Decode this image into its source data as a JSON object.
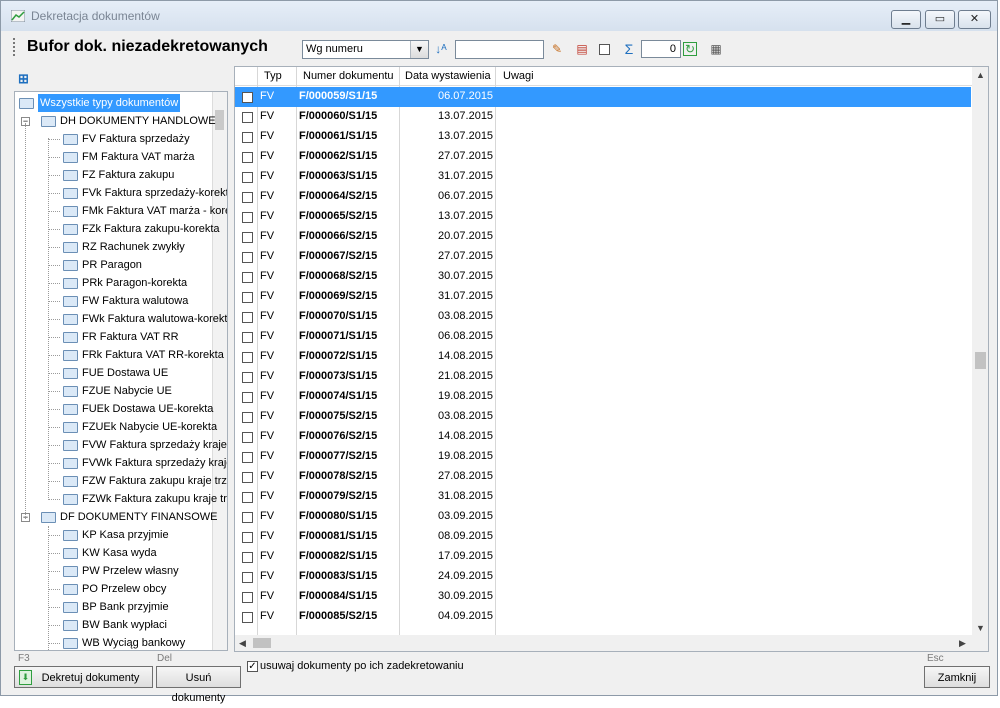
{
  "window": {
    "title": "Dekretacja dokumentów"
  },
  "toolbar": {
    "heading": "Bufor dok. niezadekretowanych",
    "sort_option": "Wg numeru",
    "search_value": "",
    "counter_value": "0"
  },
  "tree": {
    "items": [
      {
        "label": "Wszystkie typy dokumentów",
        "level": 0
      },
      {
        "label": "DH  DOKUMENTY HANDLOWE",
        "level": 1
      },
      {
        "label": "FV  Faktura sprzedaży",
        "level": 2
      },
      {
        "label": "FM  Faktura VAT marża",
        "level": 2
      },
      {
        "label": "FZ  Faktura zakupu",
        "level": 2
      },
      {
        "label": "FVk  Faktura sprzedaży-korekta",
        "level": 2
      },
      {
        "label": "FMk  Faktura VAT marża - korekta",
        "level": 2
      },
      {
        "label": "FZk  Faktura zakupu-korekta",
        "level": 2
      },
      {
        "label": "RZ  Rachunek zwykły",
        "level": 2
      },
      {
        "label": "PR  Paragon",
        "level": 2
      },
      {
        "label": "PRk  Paragon-korekta",
        "level": 2
      },
      {
        "label": "FW  Faktura walutowa",
        "level": 2
      },
      {
        "label": "FWk  Faktura walutowa-korekta",
        "level": 2
      },
      {
        "label": "FR  Faktura VAT RR",
        "level": 2
      },
      {
        "label": "FRk  Faktura VAT RR-korekta",
        "level": 2
      },
      {
        "label": "FUE  Dostawa UE",
        "level": 2
      },
      {
        "label": "FZUE  Nabycie UE",
        "level": 2
      },
      {
        "label": "FUEk  Dostawa UE-korekta",
        "level": 2
      },
      {
        "label": "FZUEk  Nabycie UE-korekta",
        "level": 2
      },
      {
        "label": "FVW  Faktura sprzedaży kraje trzecie",
        "level": 2
      },
      {
        "label": "FVWk  Faktura sprzedaży kraje trzecie",
        "level": 2
      },
      {
        "label": "FZW  Faktura zakupu kraje trzecie",
        "level": 2
      },
      {
        "label": "FZWk  Faktura zakupu kraje trzecie",
        "level": 2
      },
      {
        "label": "DF  DOKUMENTY FINANSOWE",
        "level": 1
      },
      {
        "label": "KP  Kasa przyjmie",
        "level": 2
      },
      {
        "label": "KW  Kasa wyda",
        "level": 2
      },
      {
        "label": "PW  Przelew własny",
        "level": 2
      },
      {
        "label": "PO  Przelew obcy",
        "level": 2
      },
      {
        "label": "BP  Bank przyjmie",
        "level": 2
      },
      {
        "label": "BW  Bank wypłaci",
        "level": 2
      },
      {
        "label": "WB  Wyciąg bankowy",
        "level": 2
      }
    ]
  },
  "grid": {
    "columns": [
      "Typ",
      "Numer dokumentu",
      "Data wystawienia",
      "Uwagi"
    ],
    "rows": [
      {
        "typ": "FV",
        "numer": "F/000059/S1/15",
        "data": "06.07.2015",
        "selected": true
      },
      {
        "typ": "FV",
        "numer": "F/000060/S1/15",
        "data": "13.07.2015"
      },
      {
        "typ": "FV",
        "numer": "F/000061/S1/15",
        "data": "13.07.2015"
      },
      {
        "typ": "FV",
        "numer": "F/000062/S1/15",
        "data": "27.07.2015"
      },
      {
        "typ": "FV",
        "numer": "F/000063/S1/15",
        "data": "31.07.2015"
      },
      {
        "typ": "FV",
        "numer": "F/000064/S2/15",
        "data": "06.07.2015"
      },
      {
        "typ": "FV",
        "numer": "F/000065/S2/15",
        "data": "13.07.2015"
      },
      {
        "typ": "FV",
        "numer": "F/000066/S2/15",
        "data": "20.07.2015"
      },
      {
        "typ": "FV",
        "numer": "F/000067/S2/15",
        "data": "27.07.2015"
      },
      {
        "typ": "FV",
        "numer": "F/000068/S2/15",
        "data": "30.07.2015"
      },
      {
        "typ": "FV",
        "numer": "F/000069/S2/15",
        "data": "31.07.2015"
      },
      {
        "typ": "FV",
        "numer": "F/000070/S1/15",
        "data": "03.08.2015"
      },
      {
        "typ": "FV",
        "numer": "F/000071/S1/15",
        "data": "06.08.2015"
      },
      {
        "typ": "FV",
        "numer": "F/000072/S1/15",
        "data": "14.08.2015"
      },
      {
        "typ": "FV",
        "numer": "F/000073/S1/15",
        "data": "21.08.2015"
      },
      {
        "typ": "FV",
        "numer": "F/000074/S1/15",
        "data": "19.08.2015"
      },
      {
        "typ": "FV",
        "numer": "F/000075/S2/15",
        "data": "03.08.2015"
      },
      {
        "typ": "FV",
        "numer": "F/000076/S2/15",
        "data": "14.08.2015"
      },
      {
        "typ": "FV",
        "numer": "F/000077/S2/15",
        "data": "19.08.2015"
      },
      {
        "typ": "FV",
        "numer": "F/000078/S2/15",
        "data": "27.08.2015"
      },
      {
        "typ": "FV",
        "numer": "F/000079/S2/15",
        "data": "31.08.2015"
      },
      {
        "typ": "FV",
        "numer": "F/000080/S1/15",
        "data": "03.09.2015"
      },
      {
        "typ": "FV",
        "numer": "F/000081/S1/15",
        "data": "08.09.2015"
      },
      {
        "typ": "FV",
        "numer": "F/000082/S1/15",
        "data": "17.09.2015"
      },
      {
        "typ": "FV",
        "numer": "F/000083/S1/15",
        "data": "24.09.2015"
      },
      {
        "typ": "FV",
        "numer": "F/000084/S1/15",
        "data": "30.09.2015"
      },
      {
        "typ": "FV",
        "numer": "F/000085/S2/15",
        "data": "04.09.2015"
      }
    ]
  },
  "footer": {
    "hotkey_decree": "F3",
    "decree_button": "Dekretuj dokumenty",
    "hotkey_delete": "Del",
    "delete_button": "Usuń dokumenty",
    "remove_after_label": "usuwaj dokumenty po ich zadekretowaniu",
    "remove_after_checked": true,
    "hotkey_close": "Esc",
    "close_button": "Zamknij"
  },
  "colors": {
    "selection": "#3399ff",
    "window_bg": "#f0f0f0",
    "accent_green": "#2f9e3f"
  }
}
